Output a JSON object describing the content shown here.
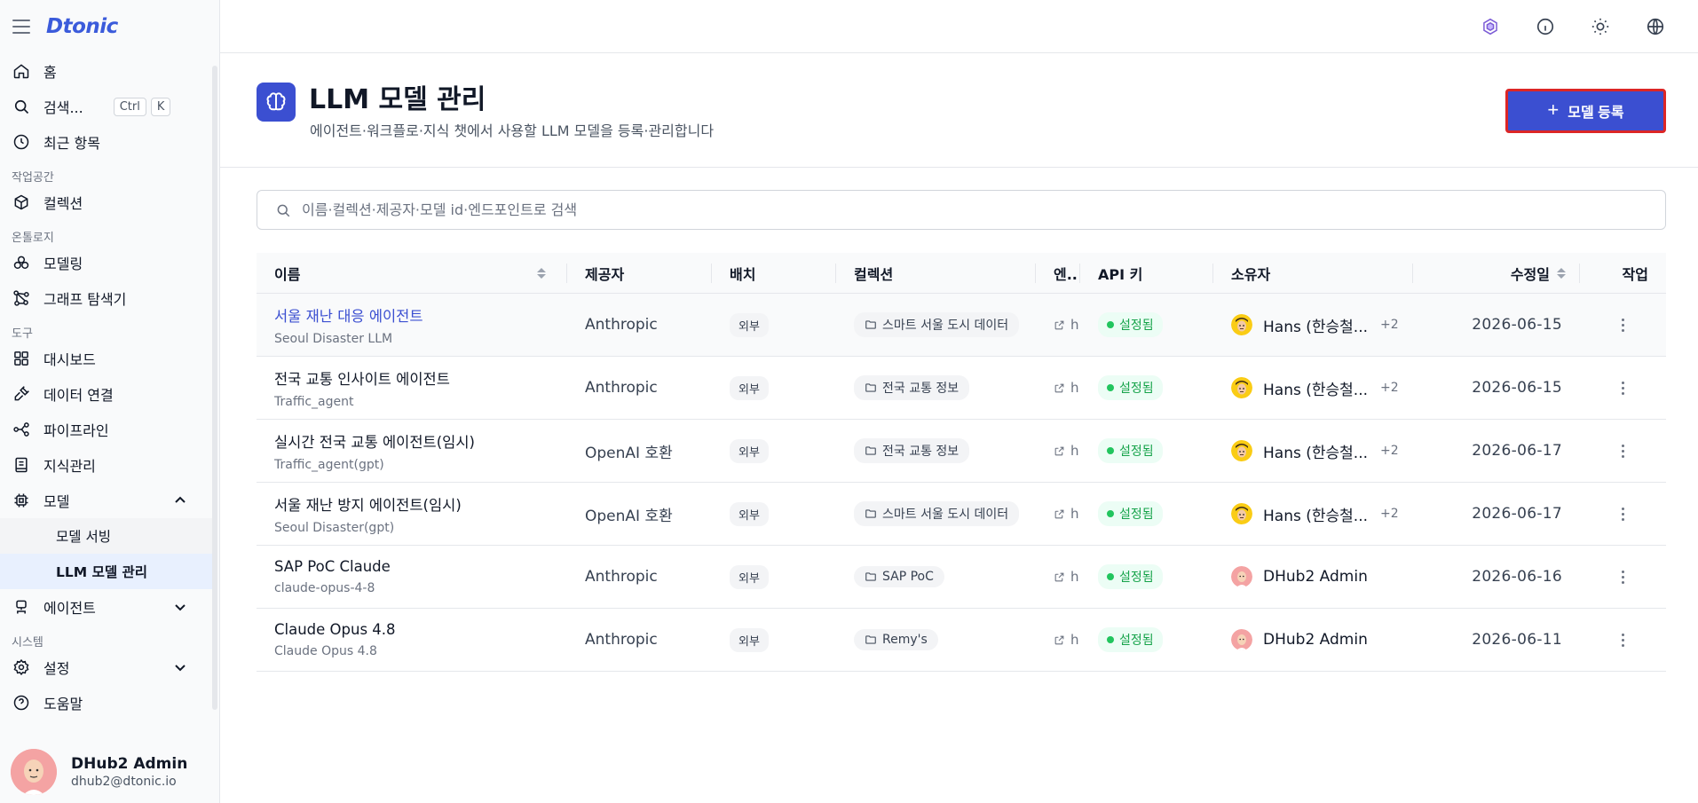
{
  "app": {
    "logo": "Dtonic"
  },
  "sidebar": {
    "home": "홈",
    "search": "검색...",
    "shortcut": [
      "Ctrl",
      "K"
    ],
    "recent": "최근 항목",
    "sections": {
      "workspace": "작업공간",
      "ontology": "온톨로지",
      "tools": "도구",
      "system": "시스템"
    },
    "collection": "컬렉션",
    "modeling": "모델링",
    "graph_explorer": "그래프 탐색기",
    "dashboard": "대시보드",
    "data_connection": "데이터 연결",
    "pipeline": "파이프라인",
    "knowledge": "지식관리",
    "model": "모델",
    "model_serving": "모델 서빙",
    "llm_model_mgmt": "LLM 모델 관리",
    "agent": "에이전트",
    "settings": "설정",
    "help": "도움말",
    "user": {
      "name": "DHub2 Admin",
      "email": "dhub2@dtonic.io"
    }
  },
  "page": {
    "title": "LLM 모델 관리",
    "subtitle": "에이전트·워크플로·지식 챗에서 사용할 LLM 모델을 등록·관리합니다",
    "add_button": "모델 등록",
    "search_placeholder": "이름·컬렉션·제공자·모델 id·엔드포인트로 검색"
  },
  "table": {
    "headers": {
      "name": "이름",
      "provider": "제공자",
      "deploy": "배치",
      "collection": "컬렉션",
      "endpoint": "엔..",
      "api_key": "API 키",
      "owner": "소유자",
      "updated": "수정일",
      "actions": "작업"
    },
    "rows": [
      {
        "name": "서울 재난 대응 에이전트",
        "model": "Seoul Disaster LLM",
        "provider": "Anthropic",
        "deploy": "외부",
        "collection": "스마트 서울 도시 데이터",
        "endpoint": "h",
        "api_key": "설정됨",
        "owner": "Hans (한승철...",
        "extra": "+2",
        "updated": "2026-06-15"
      },
      {
        "name": "전국 교통 인사이트 에이전트",
        "model": "Traffic_agent",
        "provider": "Anthropic",
        "deploy": "외부",
        "collection": "전국 교통 정보",
        "endpoint": "h",
        "api_key": "설정됨",
        "owner": "Hans (한승철...",
        "extra": "+2",
        "updated": "2026-06-15"
      },
      {
        "name": "실시간 전국 교통 에이전트(임시)",
        "model": "Traffic_agent(gpt)",
        "provider": "OpenAI 호환",
        "deploy": "외부",
        "collection": "전국 교통 정보",
        "endpoint": "h",
        "api_key": "설정됨",
        "owner": "Hans (한승철...",
        "extra": "+2",
        "updated": "2026-06-17"
      },
      {
        "name": "서울 재난 방지 에이전트(임시)",
        "model": "Seoul Disaster(gpt)",
        "provider": "OpenAI 호환",
        "deploy": "외부",
        "collection": "스마트 서울 도시 데이터",
        "endpoint": "h",
        "api_key": "설정됨",
        "owner": "Hans (한승철...",
        "extra": "+2",
        "updated": "2026-06-17"
      },
      {
        "name": "SAP PoC Claude",
        "model": "claude-opus-4-8",
        "provider": "Anthropic",
        "deploy": "외부",
        "collection": "SAP PoC",
        "endpoint": "h",
        "api_key": "설정됨",
        "owner": "DHub2 Admin",
        "extra": "",
        "updated": "2026-06-16"
      },
      {
        "name": "Claude Opus 4.8",
        "model": "Claude Opus 4.8",
        "provider": "Anthropic",
        "deploy": "외부",
        "collection": "Remy's",
        "endpoint": "h",
        "api_key": "설정됨",
        "owner": "DHub2 Admin",
        "extra": "",
        "updated": "2026-06-11"
      }
    ]
  },
  "colors": {
    "accent": "#3b4fd1",
    "highlight_border": "#dc2626",
    "ok": "#16a34a"
  }
}
